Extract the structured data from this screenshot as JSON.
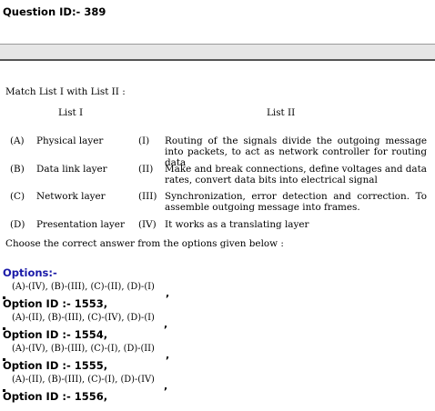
{
  "question_id": "Question ID:- 389",
  "prompt": "Match List I with List II :",
  "list1_header": "List I",
  "list2_header": "List II",
  "rows": [
    {
      "letter": "(A)",
      "term": "Physical layer",
      "roman": "(I)",
      "desc": "Routing of the signals divide the outgoing message into packets, to act as network controller for routing data"
    },
    {
      "letter": "(B)",
      "term": "Data link layer",
      "roman": "(II)",
      "desc": "Make and break connections, define voltages and data rates, convert data bits into electrical signal"
    },
    {
      "letter": "(C)",
      "term": "Network layer",
      "roman": "(III)",
      "desc": "Synchronization, error detection and correction. To assemble outgoing message into frames."
    },
    {
      "letter": "(D)",
      "term": "Presentation layer",
      "roman": "(IV)",
      "desc": "It works as a translating layer"
    }
  ],
  "choose_text": "Choose the correct answer from the options given below :",
  "options_title": "Options:-",
  "options": [
    {
      "text": "(A)-(IV), (B)-(III), (C)-(II), (D)-(I)",
      "id": "Option ID :- 1553,"
    },
    {
      "text": "(A)-(II), (B)-(III), (C)-(IV), (D)-(I)",
      "id": "Option ID :- 1554,"
    },
    {
      "text": "(A)-(IV), (B)-(III), (C)-(I), (D)-(II)",
      "id": "Option ID :- 1555,"
    },
    {
      "text": "(A)-(II), (B)-(III), (C)-(I), (D)-(IV)",
      "id": "Option ID :- 1556,"
    }
  ],
  "comma": ","
}
